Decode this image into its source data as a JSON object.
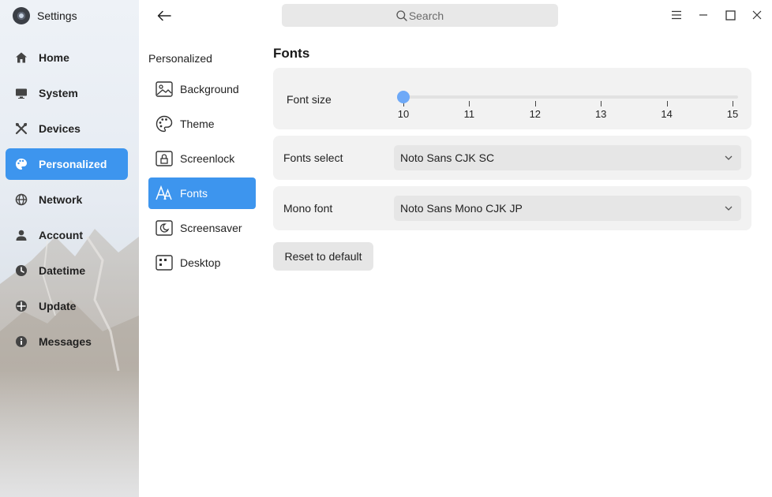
{
  "app": {
    "title": "Settings"
  },
  "search": {
    "placeholder": "Search"
  },
  "sidebar": {
    "items": [
      {
        "label": "Home",
        "icon": "home-icon",
        "active": false
      },
      {
        "label": "System",
        "icon": "monitor-icon",
        "active": false
      },
      {
        "label": "Devices",
        "icon": "tools-icon",
        "active": false
      },
      {
        "label": "Personalized",
        "icon": "palette-icon",
        "active": true
      },
      {
        "label": "Network",
        "icon": "globe-icon",
        "active": false
      },
      {
        "label": "Account",
        "icon": "user-icon",
        "active": false
      },
      {
        "label": "Datetime",
        "icon": "clock-icon",
        "active": false
      },
      {
        "label": "Update",
        "icon": "update-icon",
        "active": false
      },
      {
        "label": "Messages",
        "icon": "info-icon",
        "active": false
      }
    ]
  },
  "subnav": {
    "title": "Personalized",
    "items": [
      {
        "label": "Background",
        "icon": "image-icon",
        "active": false
      },
      {
        "label": "Theme",
        "icon": "palette-icon",
        "active": false
      },
      {
        "label": "Screenlock",
        "icon": "screenlock-icon",
        "active": false
      },
      {
        "label": "Fonts",
        "icon": "fonts-icon",
        "active": true
      },
      {
        "label": "Screensaver",
        "icon": "screensaver-icon",
        "active": false
      },
      {
        "label": "Desktop",
        "icon": "desktop-grid-icon",
        "active": false
      }
    ]
  },
  "content": {
    "title": "Fonts",
    "font_size": {
      "label": "Font size",
      "ticks": [
        "10",
        "11",
        "12",
        "13",
        "14",
        "15"
      ],
      "value": 10
    },
    "fonts_select": {
      "label": "Fonts select",
      "value": "Noto Sans CJK SC"
    },
    "mono_font": {
      "label": "Mono font",
      "value": "Noto Sans Mono CJK JP"
    },
    "reset_label": "Reset to default"
  },
  "colors": {
    "accent": "#3d95ee",
    "slider_handle": "#6ea9f7",
    "card": "#f2f2f2"
  }
}
